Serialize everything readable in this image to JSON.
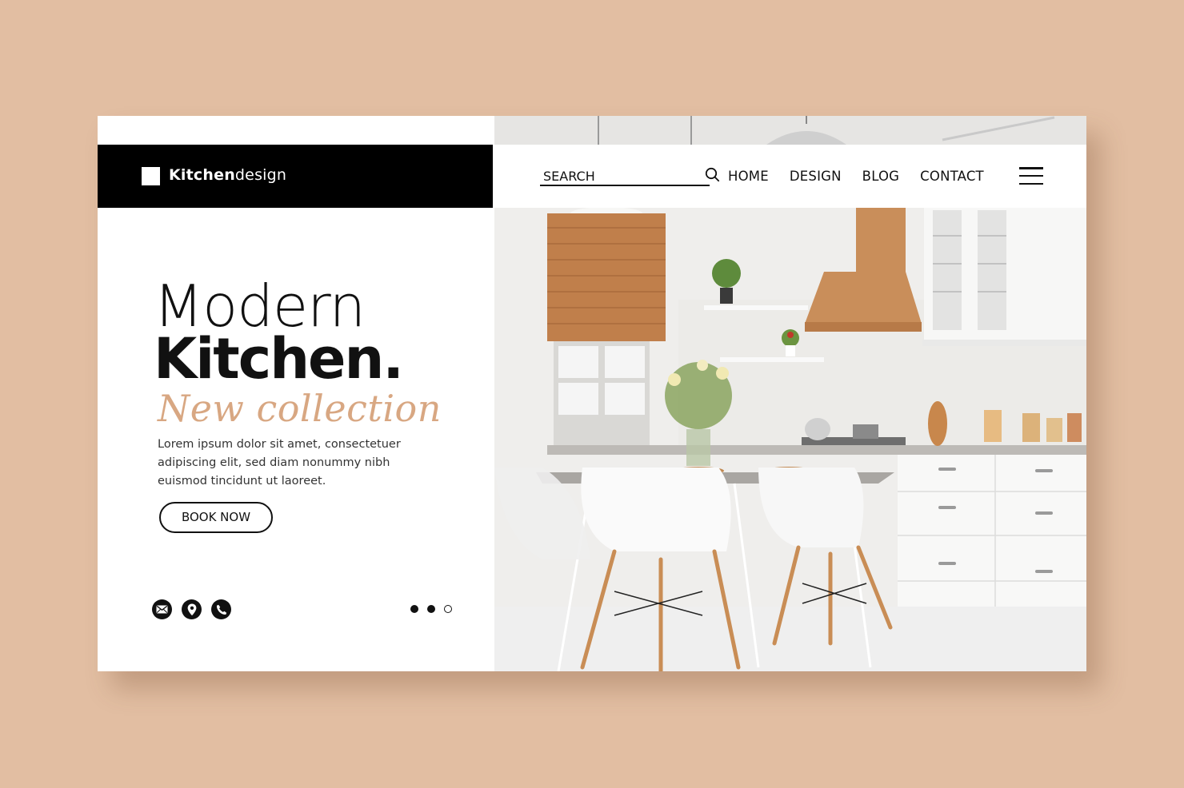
{
  "brand": {
    "name_bold": "Kitchen",
    "name_light": "design"
  },
  "nav": {
    "search_placeholder": "SEARCH",
    "links": [
      "HOME",
      "DESIGN",
      "BLOG",
      "CONTACT"
    ]
  },
  "hero": {
    "title_line1": "Modern",
    "title_line2": "Kitchen.",
    "script": "New collection",
    "description": "Lorem ipsum dolor sit amet, consectetuer adipiscing elit, sed diam nonummy nibh euismod tincidunt ut laoreet.",
    "cta_label": "BOOK NOW"
  },
  "contact_icons": [
    "mail-icon",
    "location-pin-icon",
    "phone-icon"
  ],
  "carousel": {
    "total": 3,
    "active_states": [
      "filled",
      "filled",
      "empty"
    ]
  },
  "colors": {
    "background": "#e2bea2",
    "accent_script": "#d8a782",
    "dark": "#111111",
    "logo_bar": "#000000"
  }
}
